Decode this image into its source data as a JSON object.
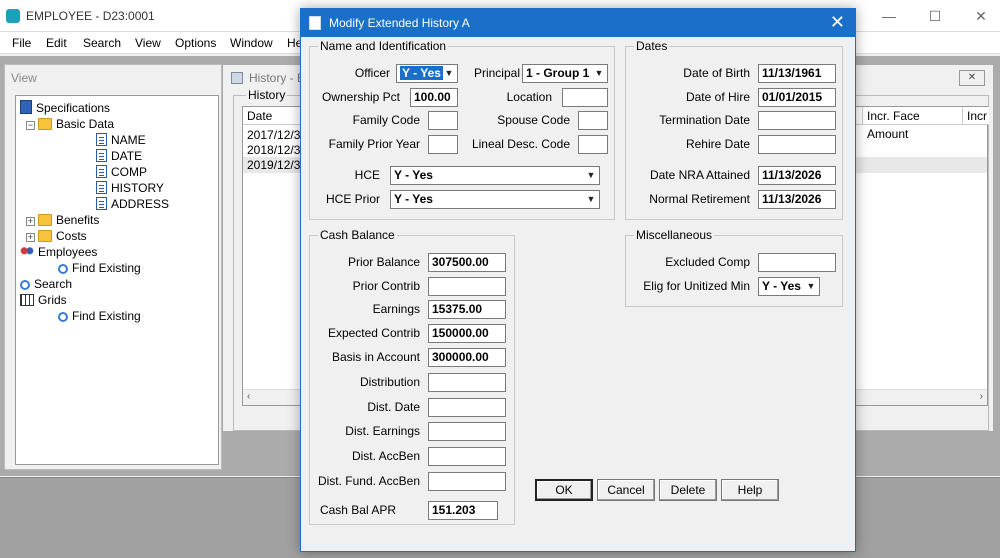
{
  "app": {
    "title": "EMPLOYEE - D23:0001",
    "menu": [
      "File",
      "Edit",
      "Search",
      "View",
      "Options",
      "Window",
      "He"
    ],
    "controls": {
      "minimize": "—",
      "maximize": "☐",
      "close": "✕"
    }
  },
  "view_pane": {
    "title": "View",
    "tree": {
      "specifications": "Specifications",
      "basic_data": "Basic Data",
      "basic_children": [
        "NAME",
        "DATE",
        "COMP",
        "HISTORY",
        "ADDRESS"
      ],
      "benefits": "Benefits",
      "costs": "Costs",
      "employees": "Employees",
      "employees_find": "Find Existing",
      "search": "Search",
      "grids": "Grids",
      "grids_find": "Find Existing"
    }
  },
  "history_window": {
    "title": "History - E",
    "close_label": "✕",
    "group_label": "History",
    "columns": {
      "date": "Date",
      "incr_face": "Incr. Face Amount",
      "incr2": "Incr"
    },
    "rows": [
      "2017/12/31",
      "2018/12/31",
      "2019/12/31"
    ],
    "scroll_left": "‹",
    "scroll_right": "›"
  },
  "dialog": {
    "title": "Modify Extended History A",
    "close": "✕",
    "name_group": {
      "label": "Name and Identification",
      "officer_label": "Officer",
      "officer_value": "Y - Yes",
      "principal_label": "Principal",
      "principal_value": "1 - Group 1",
      "ownership_label": "Ownership Pct",
      "ownership_value": "100.00",
      "location_label": "Location",
      "location_value": "",
      "family_code_label": "Family Code",
      "family_code_value": "",
      "spouse_code_label": "Spouse Code",
      "spouse_code_value": "",
      "family_prior_label": "Family Prior Year",
      "family_prior_value": "",
      "lineal_label": "Lineal Desc. Code",
      "lineal_value": "",
      "hce_label": "HCE",
      "hce_value": "Y - Yes",
      "hce_prior_label": "HCE Prior",
      "hce_prior_value": "Y - Yes"
    },
    "dates_group": {
      "label": "Dates",
      "birth_label": "Date of Birth",
      "birth_value": "11/13/1961",
      "hire_label": "Date of Hire",
      "hire_value": "01/01/2015",
      "term_label": "Termination Date",
      "term_value": "",
      "rehire_label": "Rehire Date",
      "rehire_value": "",
      "nra_label": "Date NRA Attained",
      "nra_value": "11/13/2026",
      "retire_label": "Normal Retirement",
      "retire_value": "11/13/2026"
    },
    "cash_group": {
      "label": "Cash Balance",
      "fields": [
        {
          "label": "Prior Balance",
          "value": "307500.00"
        },
        {
          "label": "Prior Contrib",
          "value": ""
        },
        {
          "label": "Earnings",
          "value": "15375.00"
        },
        {
          "label": "Expected Contrib",
          "value": "150000.00"
        },
        {
          "label": "Basis in Account",
          "value": "300000.00"
        },
        {
          "label": "Distribution",
          "value": ""
        },
        {
          "label": "Dist. Date",
          "value": ""
        },
        {
          "label": "Dist. Earnings",
          "value": ""
        },
        {
          "label": "Dist. AccBen",
          "value": ""
        },
        {
          "label": "Dist. Fund. AccBen",
          "value": ""
        },
        {
          "label": "Cash Bal APR",
          "value": "151.203"
        }
      ]
    },
    "misc_group": {
      "label": "Miscellaneous",
      "excluded_label": "Excluded Comp",
      "excluded_value": "",
      "elig_label": "Elig for Unitized Min",
      "elig_value": "Y - Yes"
    },
    "buttons": {
      "ok": "OK",
      "cancel": "Cancel",
      "delete": "Delete",
      "help": "Help"
    }
  }
}
